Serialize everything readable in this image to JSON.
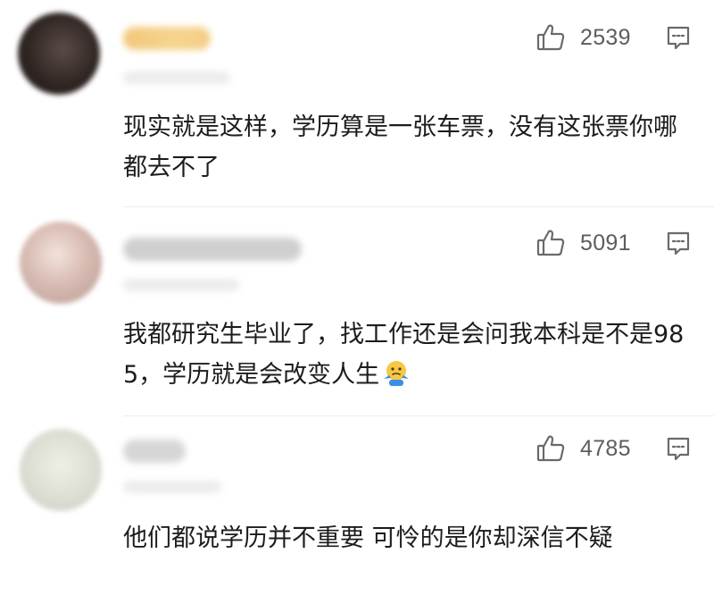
{
  "comments": [
    {
      "likes": "2539",
      "text": "现实就是这样，学历算是一张车票，没有这张票你哪都去不了",
      "avatar_tone": "#2f2623",
      "name_tone": "#f2c77a"
    },
    {
      "likes": "5091",
      "text": "我都研究生毕业了，找工作还是会问我本科是不是985，学历就是会改变人生",
      "emoji": "thinking-shrug-emoji",
      "avatar_tone": "#d8bcb3",
      "name_tone": "#cfcfcf"
    },
    {
      "likes": "4785",
      "text": "他们都说学历并不重要  可怜的是你却深信不疑",
      "avatar_tone": "#dadcd1",
      "name_tone": "#d6d6d6"
    }
  ],
  "icons": {
    "like": "thumbs-up-icon",
    "reply": "comment-bubble-icon"
  },
  "colors": {
    "text": "#1c1c1c",
    "count": "#5d5d5d",
    "divider": "#ededed"
  }
}
